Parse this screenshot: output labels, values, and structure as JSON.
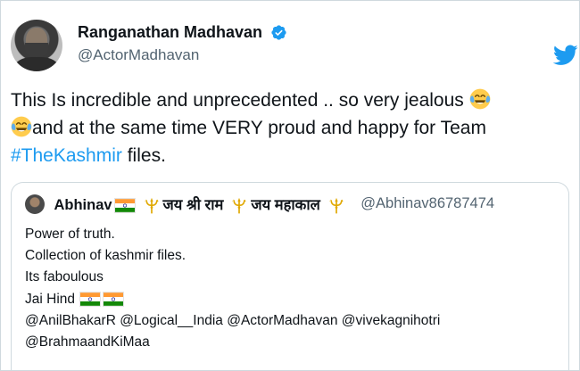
{
  "author": {
    "name": "Ranganathan Madhavan",
    "handle": "@ActorMadhavan",
    "verified": true,
    "avatar_icon": "avatar-photo"
  },
  "brand": {
    "icon": "twitter-bird-icon",
    "color": "#1d9bf0"
  },
  "tweet": {
    "text_before_emoji_1": "This Is incredible and unprecedented .. so very jealous ",
    "emoji_1": "face-with-tears-of-joy",
    "emoji_2": "face-with-tears-of-joy",
    "text_after_emojis": "and at the same time VERY proud and happy for Team ",
    "hashtag": "#TheKashmir",
    "text_end": " files."
  },
  "quoted_tweet": {
    "author_name": "Abhinav",
    "name_segment_1": "जय श्री राम",
    "name_segment_2": "जय महाकाल",
    "handle": "@Abhinav86787474",
    "lines": [
      "Power of truth.",
      "Collection of kashmir files.",
      "Its faboulous",
      "Jai Hind"
    ],
    "mentions_line_1": "@AnilBhakarR @Logical__India @ActorMadhavan @vivekagnihotri",
    "mentions_line_2": "@BrahmaandKiMaa"
  },
  "colors": {
    "text": "#0f1419",
    "secondary": "#536471",
    "link": "#1d9bf0",
    "border": "#cfd9de"
  }
}
